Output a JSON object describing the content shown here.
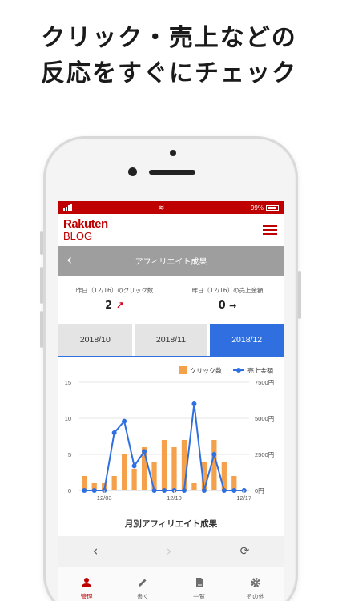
{
  "headline": {
    "line1": "クリック・売上などの",
    "line2": "反応をすぐにチェック"
  },
  "statusbar": {
    "battery": "99%"
  },
  "app": {
    "logo_line1": "Rakuten",
    "logo_line2": "BLOG"
  },
  "header": {
    "back": "‹",
    "title": "アフィリエイト成果"
  },
  "stats": {
    "clicks_label": "昨日（12/16）のクリック数",
    "clicks_value": "2",
    "clicks_arrow": "↗",
    "sales_label": "昨日（12/16）の売上金額",
    "sales_value": "0",
    "sales_arrow": "→"
  },
  "months": {
    "m1": "2018/10",
    "m2": "2018/11",
    "m3": "2018/12"
  },
  "colors": {
    "brand_red": "#bf0000",
    "accent_blue": "#2f6fe0",
    "bar_orange": "#f5a04a"
  },
  "chart_data": {
    "type": "bar+line",
    "title": "月別アフィリエイト成果",
    "legend": [
      "クリック数",
      "売上金額"
    ],
    "legend_position": "top-right",
    "left_axis": {
      "range": [
        0,
        15
      ],
      "ticks": [
        "0",
        "5",
        "10",
        "15"
      ]
    },
    "right_axis": {
      "range": [
        0,
        7500
      ],
      "ticks": [
        "0円",
        "2500円",
        "5000円",
        "7500円"
      ]
    },
    "x_tick_labels": [
      "12/03",
      "12/10",
      "12/17"
    ],
    "x_tick_days": [
      3,
      10,
      17
    ],
    "days": [
      1,
      2,
      3,
      4,
      5,
      6,
      7,
      8,
      9,
      10,
      11,
      12,
      13,
      14,
      15,
      16,
      17
    ],
    "series": [
      {
        "name": "クリック数",
        "axis": "left",
        "values": [
          2,
          1,
          1,
          2,
          5,
          3,
          6,
          4,
          7,
          6,
          7,
          1,
          4,
          7,
          4,
          2,
          0
        ]
      },
      {
        "name": "売上金額",
        "axis": "right",
        "values": [
          0,
          0,
          0,
          4000,
          4800,
          1700,
          2700,
          0,
          0,
          0,
          0,
          6000,
          0,
          2500,
          0,
          0,
          0
        ]
      }
    ]
  },
  "tabs": {
    "t1": "管理",
    "t2": "書く",
    "t3": "一覧",
    "t4": "その他"
  }
}
